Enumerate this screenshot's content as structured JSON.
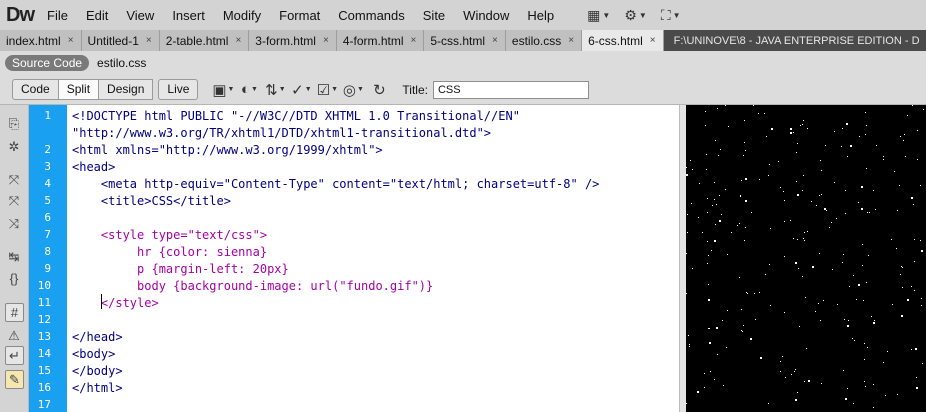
{
  "app": {
    "logo": "Dw"
  },
  "menu": [
    "File",
    "Edit",
    "View",
    "Insert",
    "Modify",
    "Format",
    "Commands",
    "Site",
    "Window",
    "Help"
  ],
  "toolbar_icons": [
    "layout-icon",
    "gear-icon",
    "extensions-icon"
  ],
  "tabs": [
    {
      "label": "index.html",
      "active": false
    },
    {
      "label": "Untitled-1",
      "active": false
    },
    {
      "label": "2-table.html",
      "active": false
    },
    {
      "label": "3-form.html",
      "active": false
    },
    {
      "label": "4-form.html",
      "active": false
    },
    {
      "label": "5-css.html",
      "active": false
    },
    {
      "label": "estilo.css",
      "active": false
    },
    {
      "label": "6-css.html",
      "active": true
    }
  ],
  "path": "F:\\UNINOVE\\8 - JAVA ENTERPRISE EDITION - D",
  "related": {
    "source_code": "Source Code",
    "file": "estilo.css"
  },
  "views": {
    "code": "Code",
    "split": "Split",
    "design": "Design",
    "live": "Live"
  },
  "title_label": "Title:",
  "title_value": "CSS",
  "code_lines": [
    {
      "n": "1",
      "t": "<!DOCTYPE html PUBLIC \"-//W3C//DTD XHTML 1.0 Transitional//EN\""
    },
    {
      "n": "",
      "t": "\"http://www.w3.org/TR/xhtml1/DTD/xhtml1-transitional.dtd\">"
    },
    {
      "n": "2",
      "t": "<html xmlns=\"http://www.w3.org/1999/xhtml\">"
    },
    {
      "n": "3",
      "t": "<head>"
    },
    {
      "n": "4",
      "t": "    <meta http-equiv=\"Content-Type\" content=\"text/html; charset=utf-8\" />"
    },
    {
      "n": "5",
      "t": "    <title>CSS</title>"
    },
    {
      "n": "6",
      "t": ""
    },
    {
      "n": "7",
      "t": "    <style type=\"text/css\">"
    },
    {
      "n": "8",
      "t": "         hr {color: sienna}"
    },
    {
      "n": "9",
      "t": "         p {margin-left: 20px}"
    },
    {
      "n": "10",
      "t": "         body {background-image: url(\"fundo.gif\")}"
    },
    {
      "n": "11",
      "t": "    </style>"
    },
    {
      "n": "12",
      "t": ""
    },
    {
      "n": "13",
      "t": "</head>"
    },
    {
      "n": "14",
      "t": "<body>"
    },
    {
      "n": "15",
      "t": "</body>"
    },
    {
      "n": "16",
      "t": "</html>"
    },
    {
      "n": "17",
      "t": ""
    }
  ],
  "colors": {
    "linenum_bg": "#1aa0f0",
    "tag": "#000080",
    "css": "#a500a5",
    "preview_bg": "#000000"
  }
}
